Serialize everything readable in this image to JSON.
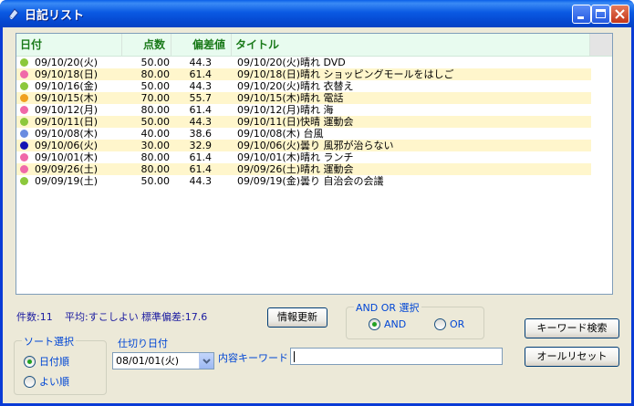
{
  "window": {
    "title": "日記リスト"
  },
  "columns": {
    "date": "日付",
    "score": "点数",
    "deviation": "偏差値",
    "title": "タイトル"
  },
  "rows": [
    {
      "date": "09/10/20(火)",
      "score": "50.00",
      "deviation": "44.3",
      "title": "09/10/20(火)晴れ  DVD",
      "dot_color": "#8cc83c"
    },
    {
      "date": "09/10/18(日)",
      "score": "80.00",
      "deviation": "61.4",
      "title": "09/10/18(日)晴れ  ショッピングモールをはしご",
      "dot_color": "#f068a8"
    },
    {
      "date": "09/10/16(金)",
      "score": "50.00",
      "deviation": "44.3",
      "title": "09/10/20(火)晴れ  衣替え",
      "dot_color": "#8cc83c"
    },
    {
      "date": "09/10/15(木)",
      "score": "70.00",
      "deviation": "55.7",
      "title": "09/10/15(木)晴れ  電話",
      "dot_color": "#f0a020"
    },
    {
      "date": "09/10/12(月)",
      "score": "80.00",
      "deviation": "61.4",
      "title": "09/10/12(月)晴れ  海",
      "dot_color": "#f068a8"
    },
    {
      "date": "09/10/11(日)",
      "score": "50.00",
      "deviation": "44.3",
      "title": "09/10/11(日)快晴  運動会",
      "dot_color": "#8cc83c"
    },
    {
      "date": "09/10/08(木)",
      "score": "40.00",
      "deviation": "38.6",
      "title": "09/10/08(木)  台風",
      "dot_color": "#6a8ce0"
    },
    {
      "date": "09/10/06(火)",
      "score": "30.00",
      "deviation": "32.9",
      "title": "09/10/06(火)曇り  風邪が治らない",
      "dot_color": "#1414b4"
    },
    {
      "date": "09/10/01(木)",
      "score": "80.00",
      "deviation": "61.4",
      "title": "09/10/01(木)晴れ  ランチ",
      "dot_color": "#f068a8"
    },
    {
      "date": "09/09/26(土)",
      "score": "80.00",
      "deviation": "61.4",
      "title": "09/09/26(土)晴れ  運動会",
      "dot_color": "#f068a8"
    },
    {
      "date": "09/09/19(土)",
      "score": "50.00",
      "deviation": "44.3",
      "title": "09/09/19(金)曇り  自治会の会議",
      "dot_color": "#8cc83c"
    }
  ],
  "status": {
    "count": "件数:11",
    "average": "平均:すこしよい",
    "stddev": "標準偏差:17.6"
  },
  "buttons": {
    "refresh": "情報更新",
    "keyword_search": "キーワード検索",
    "reset_all": "オールリセット"
  },
  "and_or": {
    "legend": "AND OR 選択",
    "and": "AND",
    "or": "OR",
    "selected": "AND"
  },
  "sort": {
    "legend": "ソート選択",
    "by_date": "日付順",
    "by_good": "よい順",
    "selected": "日付順"
  },
  "cutoff": {
    "label": "仕切り日付",
    "value": "08/01/01(火)"
  },
  "keyword": {
    "label": "内容キーワード",
    "value": ""
  },
  "colors": {
    "title_bar": "#0a5ae3",
    "header_text": "#1a7a1a",
    "alt_row": "#fff6cc",
    "label_blue": "#0046d5"
  }
}
